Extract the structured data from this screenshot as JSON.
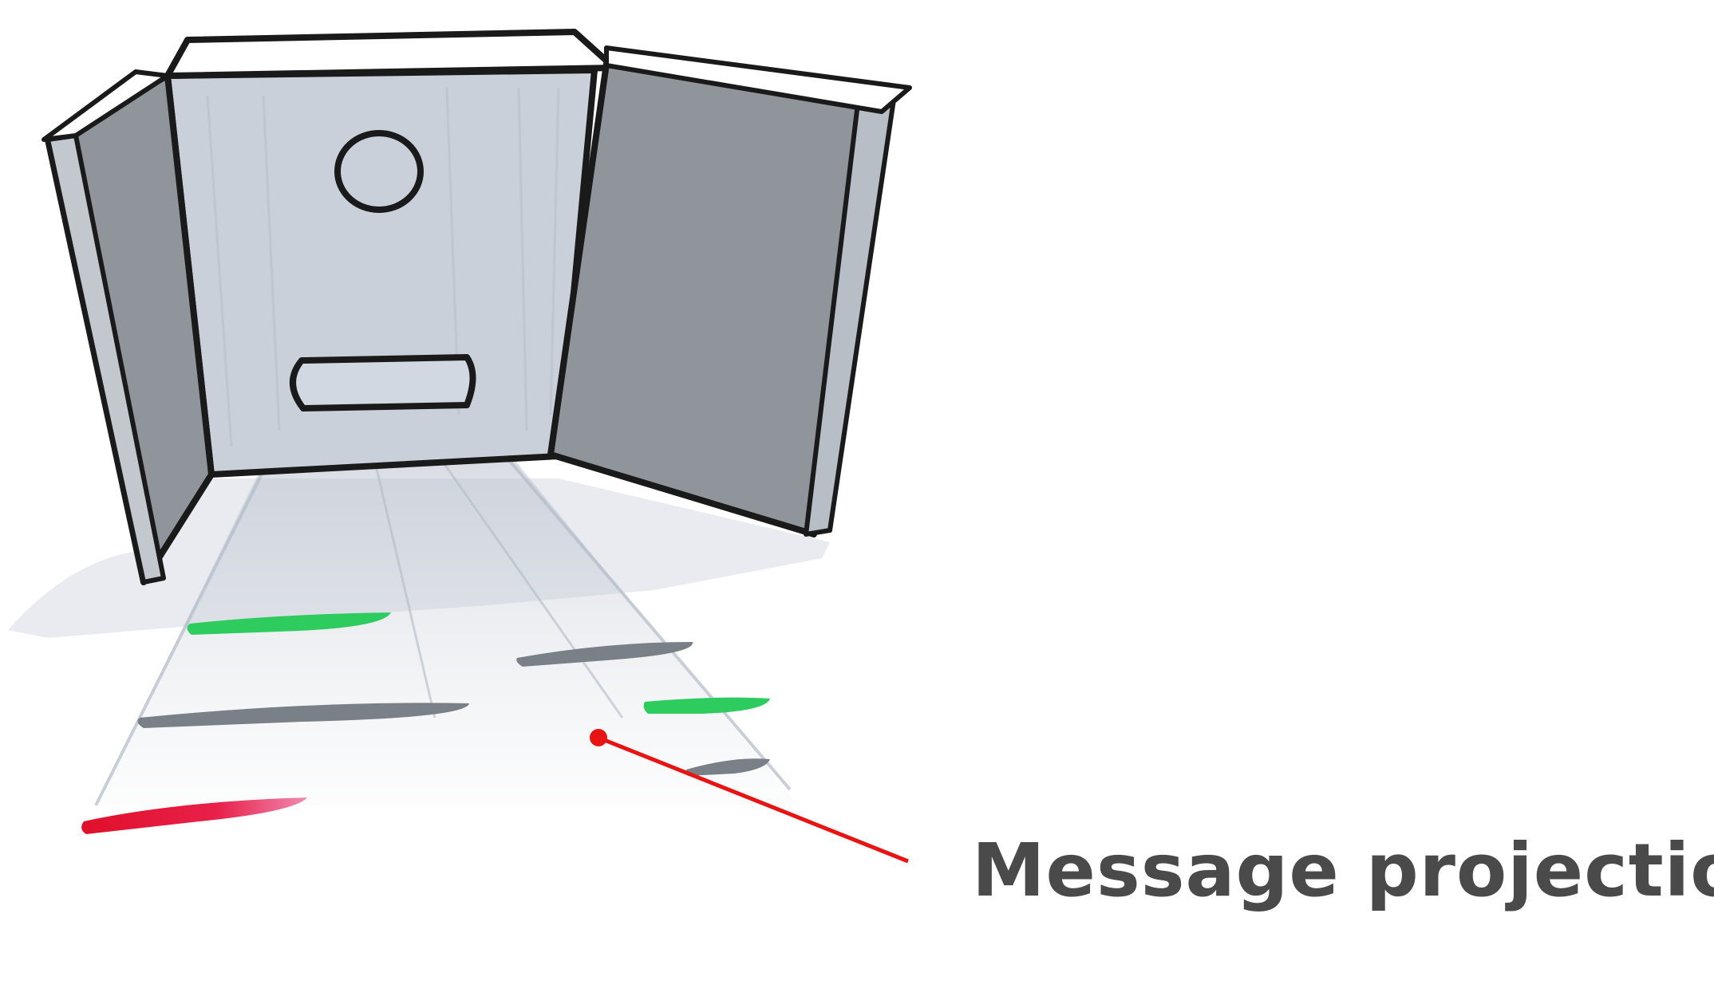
{
  "annotation": {
    "label": "Message projection",
    "text_color": "#4a4a4a",
    "leader_color": "#e81414"
  },
  "colors": {
    "outline": "#1a1a1a",
    "side_panel": "#8f959b",
    "back_panel": "#c9d0da",
    "shadow": "#dde1e8",
    "stripe_green": "#2ecc5f",
    "stripe_gray": "#7a8088",
    "stripe_red": "#e01f3a"
  },
  "icons": {
    "projector_lens": "circle-lens-icon",
    "projector_slot": "slot-icon"
  }
}
